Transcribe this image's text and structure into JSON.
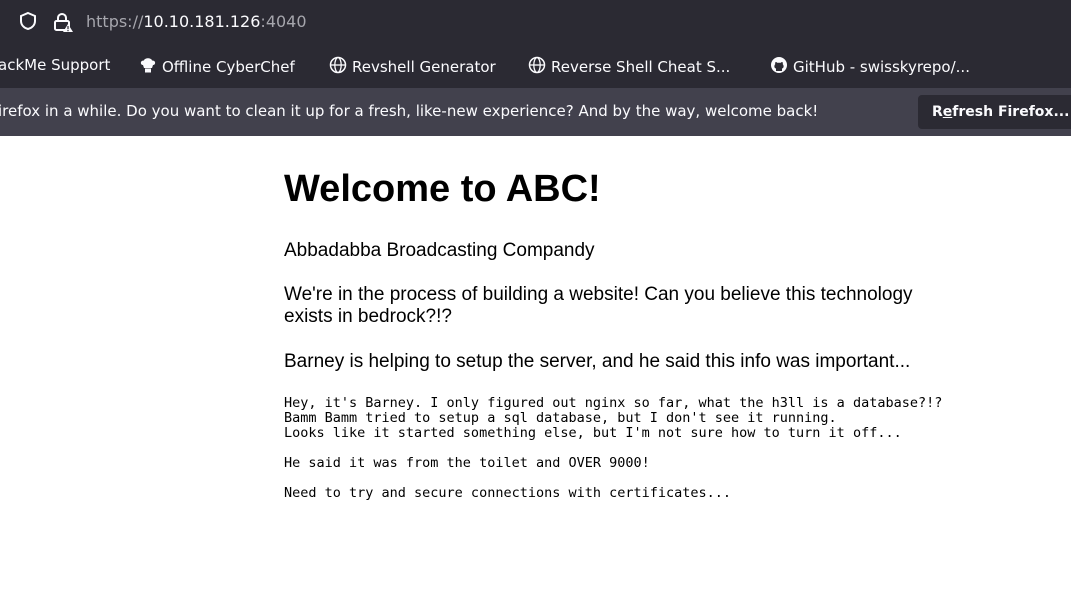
{
  "browser": {
    "url_prefix": "https://",
    "url_host": "10.10.181.126",
    "url_port": ":4040",
    "bookmarks": [
      {
        "label": "ackMe Support"
      },
      {
        "label": "Offline CyberChef"
      },
      {
        "label": "Revshell Generator"
      },
      {
        "label": "Reverse Shell Cheat S..."
      },
      {
        "label": "GitHub - swisskyrepo/..."
      }
    ],
    "notification": {
      "text": "irefox in a while. Do you want to clean it up for a fresh, like-new experience? And by the way, welcome back!",
      "button_pre": "R",
      "button_underline": "e",
      "button_post": "fresh Firefox..."
    }
  },
  "page": {
    "title": "Welcome to ABC!",
    "subtitle": "Abbadabba Broadcasting Compandy",
    "para1": "We're in the process of building a website! Can you believe this technology exists in bedrock?!?",
    "para2": "Barney is helping to setup the server, and he said this info was important...",
    "note": "Hey, it's Barney. I only figured out nginx so far, what the h3ll is a database?!?\nBamm Bamm tried to setup a sql database, but I don't see it running.\nLooks like it started something else, but I'm not sure how to turn it off...\n\nHe said it was from the toilet and OVER 9000!\n\nNeed to try and secure connections with certificates..."
  }
}
